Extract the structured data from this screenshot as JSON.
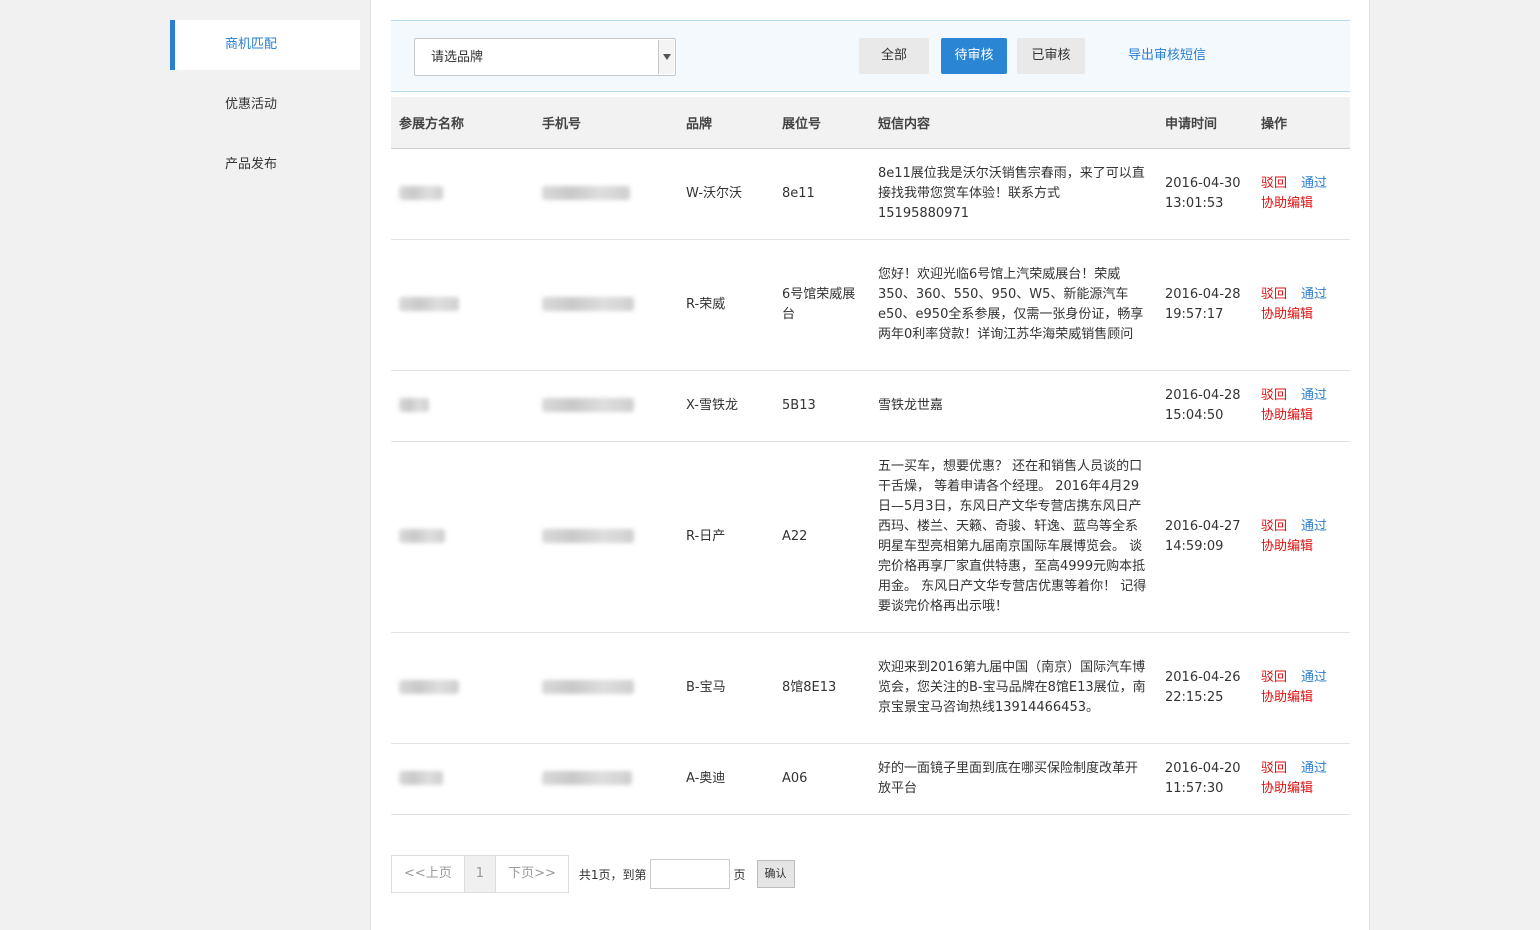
{
  "sidebar": {
    "items": [
      {
        "label": "商机匹配",
        "active": true
      },
      {
        "label": "优惠活动",
        "active": false
      },
      {
        "label": "产品发布",
        "active": false
      }
    ]
  },
  "filter": {
    "brand_placeholder": "请选品牌",
    "tabs": [
      "全部",
      "待审核",
      "已审核"
    ],
    "active_tab": "待审核",
    "export_label": "导出审核短信"
  },
  "table": {
    "headers": [
      "参展方名称",
      "手机号",
      "品牌",
      "展位号",
      "短信内容",
      "申请时间",
      "操作"
    ],
    "rows": [
      {
        "brand": "W-沃尔沃",
        "booth": "8e11",
        "sms": "8e11展位我是沃尔沃销售宗春雨，来了可以直接找我带您赏车体验！联系方式15195880971",
        "date": "2016-04-30",
        "time": "13:01:53"
      },
      {
        "brand": "R-荣威",
        "booth": "6号馆荣威展台",
        "sms": "您好！欢迎光临6号馆上汽荣威展台！荣威350、360、550、950、W5、新能源汽车e50、e950全系参展，仅需一张身份证，畅享两年0利率贷款！详询江苏华海荣威销售顾问",
        "date": "2016-04-28",
        "time": "19:57:17"
      },
      {
        "brand": "X-雪铁龙",
        "booth": "5B13",
        "sms": "雪铁龙世嘉",
        "date": "2016-04-28",
        "time": "15:04:50"
      },
      {
        "brand": "R-日产",
        "booth": "A22",
        "sms": "五一买车，想要优惠？ 还在和销售人员谈的口干舌燥， 等着申请各个经理。 2016年4月29日—5月3日，东风日产文华专营店携东风日产西玛、楼兰、天籁、奇骏、轩逸、蓝鸟等全系明星车型亮相第九届南京国际车展博览会。 谈完价格再享厂家直供特惠，至高4999元购本抵用金。 东风日产文华专营店优惠等着你！ 记得要谈完价格再出示哦！",
        "date": "2016-04-27",
        "time": "14:59:09"
      },
      {
        "brand": "B-宝马",
        "booth": "8馆8E13",
        "sms": "欢迎来到2016第九届中国（南京）国际汽车博览会，您关注的B-宝马品牌在8馆E13展位，南京宝景宝马咨询热线13914466453。",
        "date": "2016-04-26",
        "time": "22:15:25"
      },
      {
        "brand": "A-奥迪",
        "booth": "A06",
        "sms": "好的一面镜子里面到底在哪买保险制度改革开放平台",
        "date": "2016-04-20",
        "time": "11:57:30"
      }
    ],
    "ops": {
      "reject": "驳回",
      "approve": "通过",
      "edit": "协助编辑"
    }
  },
  "pager": {
    "prev": "<<上页",
    "page": "1",
    "next": "下页>>",
    "total_text": "共1页，到第",
    "page_unit": "页",
    "confirm": "确认"
  },
  "colors": {
    "accent": "#2a86d5",
    "link": "#2a7fd0",
    "danger": "#e01010"
  }
}
